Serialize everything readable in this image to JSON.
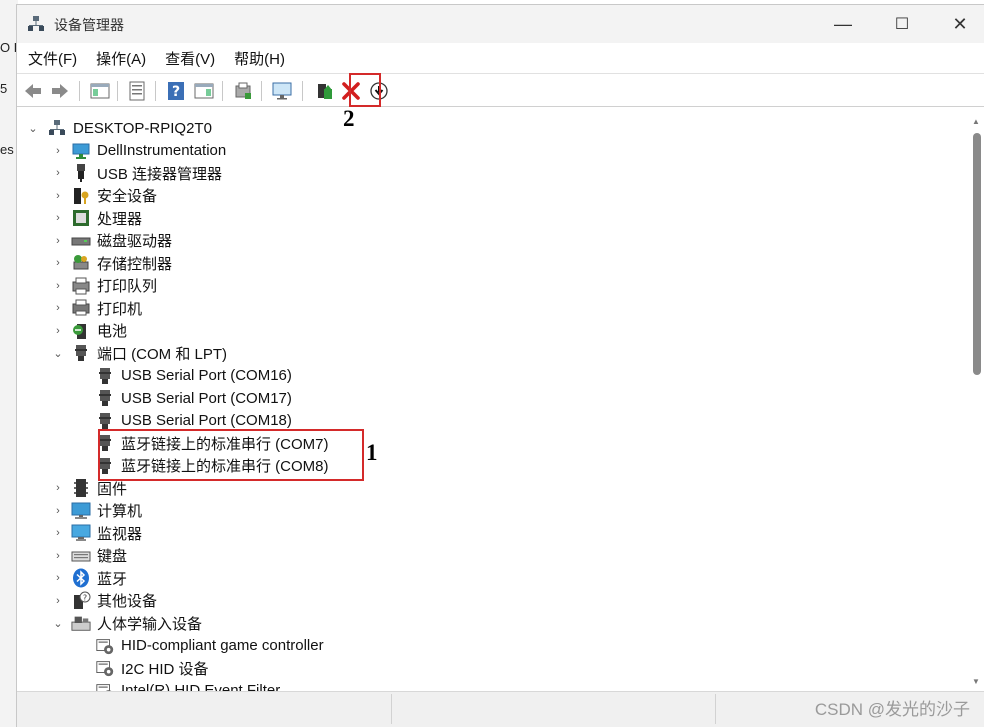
{
  "background_app": {
    "fragments": [
      "O E",
      "5",
      "es"
    ]
  },
  "window": {
    "title": "设备管理器",
    "controls": {
      "minimize": "—",
      "maximize": "☐",
      "close": "✕"
    }
  },
  "menu": [
    "文件(F)",
    "操作(A)",
    "查看(V)",
    "帮助(H)"
  ],
  "annotations": {
    "toolbar_marker": "2",
    "ports_marker": "1",
    "highlight_color": "#d42a2a"
  },
  "tree": {
    "root": "DESKTOP-RPIQ2T0",
    "categories": [
      {
        "label": "DellInstrumentation",
        "icon": "monitor-network-icon",
        "expanded": false
      },
      {
        "label": "USB 连接器管理器",
        "icon": "usb-plug-icon",
        "expanded": false
      },
      {
        "label": "安全设备",
        "icon": "security-key-icon",
        "expanded": false
      },
      {
        "label": "处理器",
        "icon": "processor-chip-icon",
        "expanded": false
      },
      {
        "label": "磁盘驱动器",
        "icon": "disk-drive-icon",
        "expanded": false
      },
      {
        "label": "存储控制器",
        "icon": "storage-controller-icon",
        "expanded": false
      },
      {
        "label": "打印队列",
        "icon": "printer-queue-icon",
        "expanded": false
      },
      {
        "label": "打印机",
        "icon": "printer-icon",
        "expanded": false
      },
      {
        "label": "电池",
        "icon": "battery-icon",
        "expanded": false
      },
      {
        "label": "端口 (COM 和 LPT)",
        "icon": "port-connector-icon",
        "expanded": true,
        "children": [
          "USB Serial Port (COM16)",
          "USB Serial Port (COM17)",
          "USB Serial Port (COM18)",
          "蓝牙链接上的标准串行 (COM7)",
          "蓝牙链接上的标准串行 (COM8)"
        ]
      },
      {
        "label": "固件",
        "icon": "firmware-icon",
        "expanded": false
      },
      {
        "label": "计算机",
        "icon": "computer-icon",
        "expanded": false
      },
      {
        "label": "监视器",
        "icon": "monitor-icon",
        "expanded": false
      },
      {
        "label": "键盘",
        "icon": "keyboard-icon",
        "expanded": false
      },
      {
        "label": "蓝牙",
        "icon": "bluetooth-icon",
        "expanded": false
      },
      {
        "label": "其他设备",
        "icon": "unknown-device-icon",
        "expanded": false
      },
      {
        "label": "人体学输入设备",
        "icon": "hid-device-icon",
        "expanded": true,
        "children": [
          "HID-compliant game controller",
          "I2C HID 设备",
          "Intel(R) HID Event Filter"
        ]
      }
    ]
  },
  "watermark": "CSDN @发光的沙子"
}
